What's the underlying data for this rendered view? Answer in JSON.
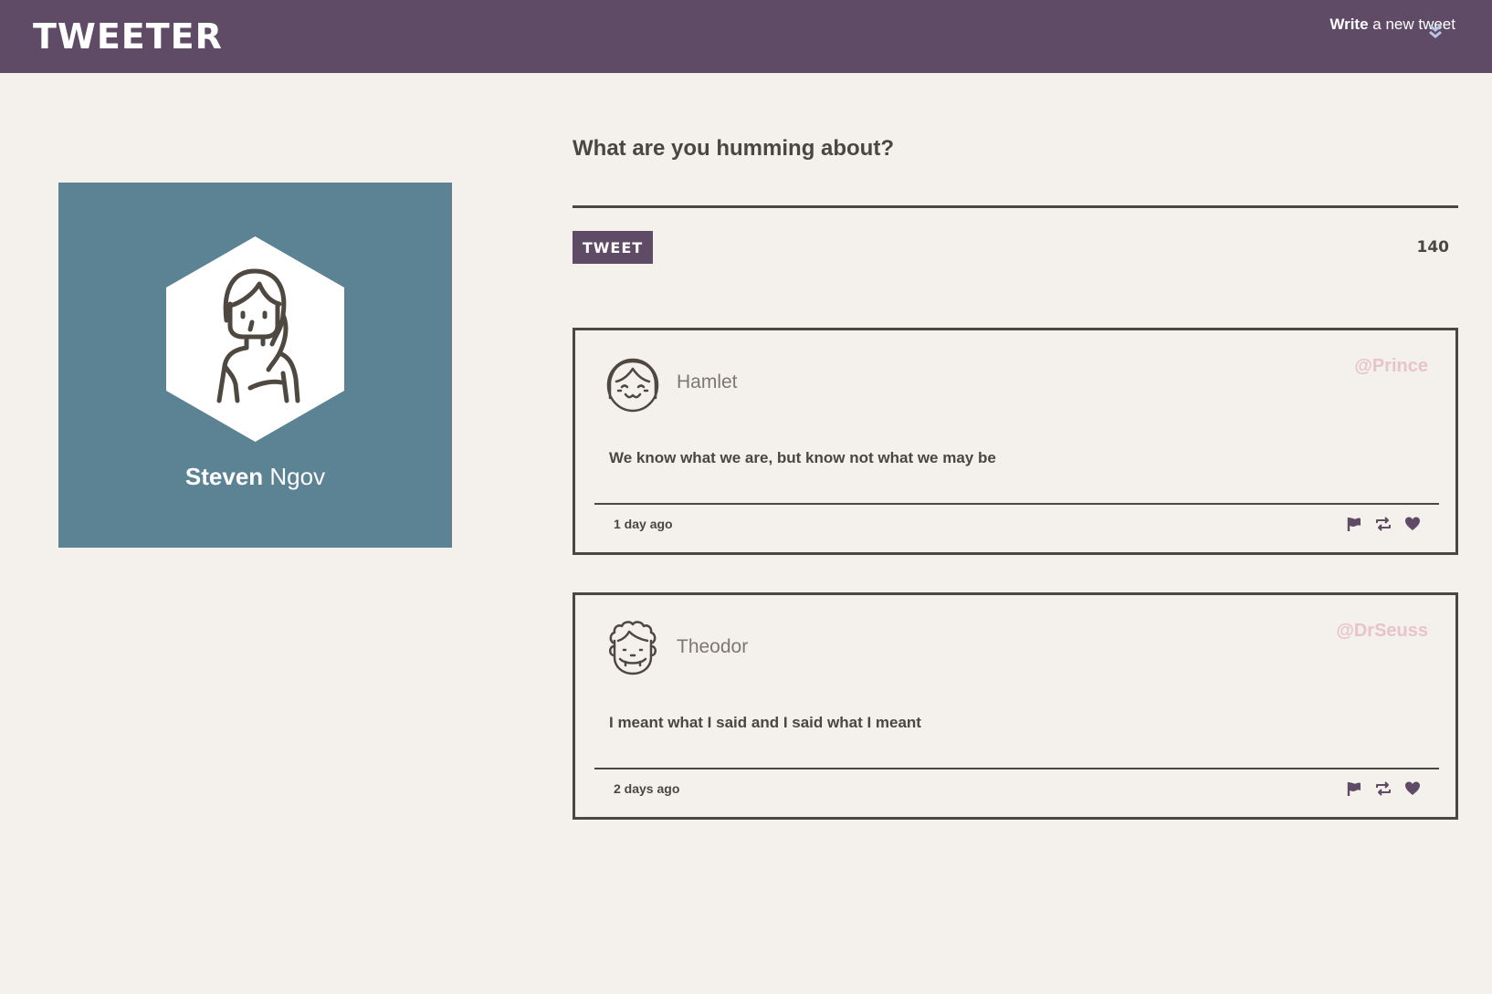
{
  "nav": {
    "brand": "TWEETER",
    "compose_bold": "Write",
    "compose_rest": " a new tweet",
    "compose_icon": "chevron-double-down-icon"
  },
  "profile": {
    "first_name": "Steven",
    "last_name": " Ngov",
    "background_color": "#5b8394"
  },
  "composer": {
    "prompt": "What are you humming about?",
    "button_label": "TWEET",
    "char_count": "140"
  },
  "tweets": [
    {
      "author": "Hamlet",
      "handle": "@Prince",
      "text": "We know what we are, but know not what we may be",
      "time": "1 day ago",
      "avatar": "girl-avatar-icon"
    },
    {
      "author": "Theodor",
      "handle": "@DrSeuss",
      "text": "I meant what I said and I said what I meant",
      "time": "2 days ago",
      "avatar": "curly-hair-avatar-icon"
    }
  ],
  "actions": [
    "flag-icon",
    "retweet-icon",
    "heart-icon"
  ],
  "colors": {
    "nav_bg": "#5f4b66",
    "page_bg": "#f4f1ec",
    "text": "#4a4640",
    "handle": "#e8c3cd",
    "accent": "#5f4b66"
  }
}
